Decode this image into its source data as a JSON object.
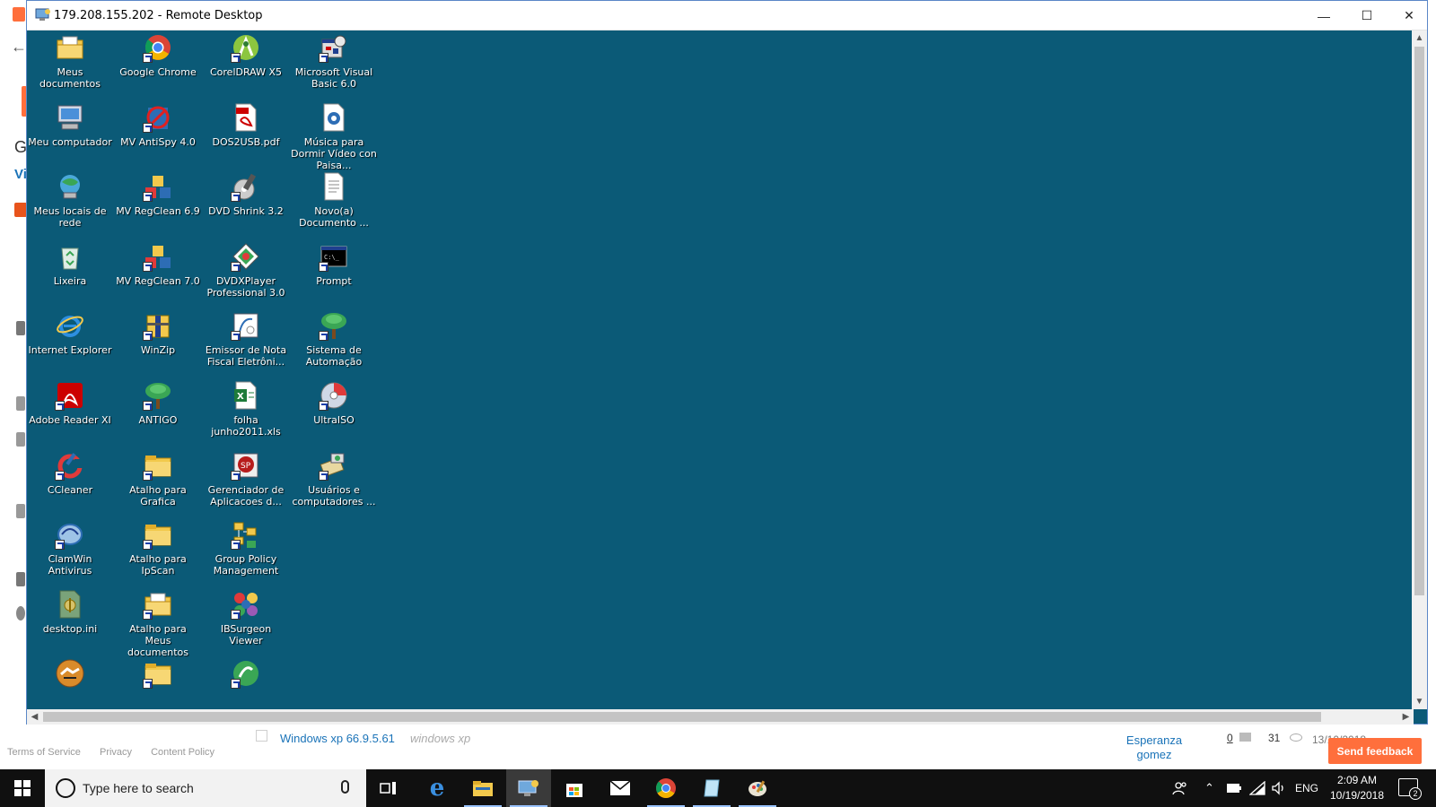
{
  "window": {
    "title": "179.208.155.202 - Remote Desktop",
    "minimize_symbol": "—",
    "maximize_symbol": "☐",
    "close_symbol": "✕"
  },
  "desktop_icons": [
    {
      "label": "Meus documentos",
      "icon": "my-documents-icon",
      "shortcut": false
    },
    {
      "label": "Google Chrome",
      "icon": "chrome-icon",
      "shortcut": true
    },
    {
      "label": "CorelDRAW X5",
      "icon": "coreldraw-icon",
      "shortcut": true
    },
    {
      "label": "Microsoft Visual Basic 6.0",
      "icon": "visual-basic-icon",
      "shortcut": true
    },
    {
      "label": "Meu computador",
      "icon": "my-computer-icon",
      "shortcut": false
    },
    {
      "label": "MV AntiSpy 4.0",
      "icon": "antispy-icon",
      "shortcut": true
    },
    {
      "label": "DOS2USB.pdf",
      "icon": "pdf-file-icon",
      "shortcut": false
    },
    {
      "label": "Música para Dormir Vídeo con Paisa...",
      "icon": "media-file-icon",
      "shortcut": false
    },
    {
      "label": "Meus locais de rede",
      "icon": "network-places-icon",
      "shortcut": false
    },
    {
      "label": "MV RegClean 6.9",
      "icon": "regclean-icon",
      "shortcut": true
    },
    {
      "label": "DVD Shrink 3.2",
      "icon": "dvd-shrink-icon",
      "shortcut": true
    },
    {
      "label": "Novo(a) Documento ...",
      "icon": "text-document-icon",
      "shortcut": false
    },
    {
      "label": "Lixeira",
      "icon": "recycle-bin-icon",
      "shortcut": false
    },
    {
      "label": "MV RegClean 7.0",
      "icon": "regclean-icon",
      "shortcut": true
    },
    {
      "label": "DVDXPlayer Professional 3.0",
      "icon": "dvdxplayer-icon",
      "shortcut": true
    },
    {
      "label": "Prompt",
      "icon": "command-prompt-icon",
      "shortcut": true
    },
    {
      "label": "Internet Explorer",
      "icon": "internet-explorer-icon",
      "shortcut": false
    },
    {
      "label": "WinZip",
      "icon": "winzip-icon",
      "shortcut": true
    },
    {
      "label": "Emissor de Nota Fiscal Eletrôni...",
      "icon": "nfe-icon",
      "shortcut": true
    },
    {
      "label": "Sistema de Automação",
      "icon": "tree-icon",
      "shortcut": true
    },
    {
      "label": "Adobe Reader XI",
      "icon": "adobe-reader-icon",
      "shortcut": true
    },
    {
      "label": "ANTIGO",
      "icon": "tree-icon",
      "shortcut": true
    },
    {
      "label": "folha junho2011.xls",
      "icon": "excel-file-icon",
      "shortcut": false
    },
    {
      "label": "UltraISO",
      "icon": "ultraiso-icon",
      "shortcut": true
    },
    {
      "label": "CCleaner",
      "icon": "ccleaner-icon",
      "shortcut": true
    },
    {
      "label": "Atalho para Grafica",
      "icon": "folder-icon",
      "shortcut": true
    },
    {
      "label": "Gerenciador de Aplicacoes d...",
      "icon": "app-manager-icon",
      "shortcut": true
    },
    {
      "label": "Usuários e computadores ...",
      "icon": "users-computers-icon",
      "shortcut": true
    },
    {
      "label": "ClamWin Antivirus",
      "icon": "clamwin-icon",
      "shortcut": true
    },
    {
      "label": "Atalho para IpScan",
      "icon": "folder-icon",
      "shortcut": true
    },
    {
      "label": "Group Policy Management",
      "icon": "group-policy-icon",
      "shortcut": true
    },
    {
      "label": "",
      "icon": "",
      "shortcut": false
    },
    {
      "label": "desktop.ini",
      "icon": "ini-file-icon",
      "shortcut": false
    },
    {
      "label": "Atalho para Meus documentos",
      "icon": "my-documents-icon",
      "shortcut": true
    },
    {
      "label": "IBSurgeon Viewer",
      "icon": "ibsurgeon-icon",
      "shortcut": true
    },
    {
      "label": "",
      "icon": "",
      "shortcut": false
    },
    {
      "label": "",
      "icon": "handshake-icon",
      "shortcut": false
    },
    {
      "label": "",
      "icon": "folder-icon",
      "shortcut": true
    },
    {
      "label": "",
      "icon": "green-circle-icon",
      "shortcut": true
    }
  ],
  "browser_bg": {
    "footer_links": [
      "Terms of Service",
      "Privacy",
      "Content Policy"
    ],
    "row_title": "Windows xp 66.9.5.61",
    "row_subtitle": "windows xp",
    "row_user": "Esperanza gomez",
    "comments": "0",
    "views": "31",
    "date_partial": "13/10/2018",
    "feedback_button": "Send feedback",
    "left_letters": [
      "G",
      "Vi"
    ]
  },
  "taskbar": {
    "search_placeholder": "Type here to search",
    "language": "ENG",
    "time": "2:09 AM",
    "date": "10/19/2018",
    "notification_count": "2"
  },
  "colors": {
    "desktop": "#0b5a77",
    "taskbar": "#101010",
    "accent_blue": "#1a73b8",
    "feedback_orange": "#ff6f3c"
  }
}
